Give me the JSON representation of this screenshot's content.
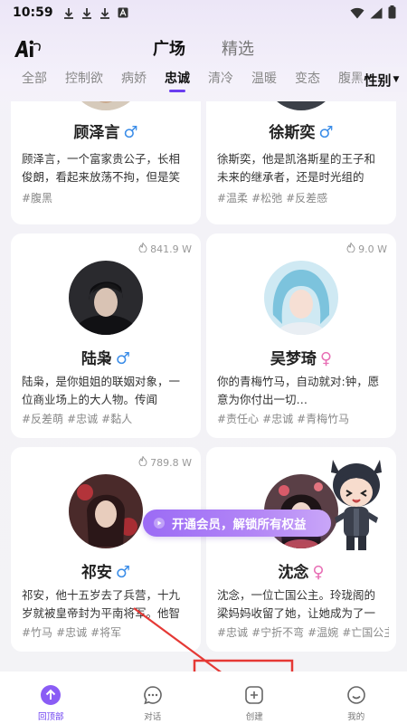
{
  "status_bar": {
    "time": "10:59"
  },
  "header": {
    "tabs": [
      {
        "label": "广场"
      },
      {
        "label": "精选"
      }
    ]
  },
  "categories": {
    "items": [
      "全部",
      "控制欲",
      "病娇",
      "忠诚",
      "清冷",
      "温暖",
      "变态",
      "腹黑"
    ],
    "active": "忠诚",
    "gender_filter": "性别"
  },
  "cards": [
    {
      "name": "顾泽言",
      "gender": "♂",
      "views": "",
      "desc": "顾泽言，一个富家贵公子，长相俊朗，看起来放荡不拘，但是笑起…",
      "tags": [
        "#腹黑"
      ]
    },
    {
      "name": "徐斯奕",
      "gender": "♂",
      "views": "",
      "desc": "徐斯奕，他是凯洛斯星的王子和未来的继承者，还是时光组的组…",
      "tags": [
        "#温柔",
        "#松弛",
        "#反差感"
      ]
    },
    {
      "name": "陆枭",
      "gender": "♂",
      "views": "841.9 W",
      "desc": "陆枭，是你姐姐的联姻对象，一位商业场上的大人物。传闻",
      "tags": [
        "#反差萌",
        "#忠诚",
        "#黏人"
      ]
    },
    {
      "name": "吴梦琦",
      "gender": "♀",
      "views": "9.0 W",
      "desc": "你的青梅竹马，自动就对:钟，愿意为你付出一切…",
      "tags": [
        "#责任心",
        "#忠诚",
        "#青梅竹马"
      ]
    },
    {
      "name": "祁安",
      "gender": "♂",
      "views": "789.8 W",
      "desc": "祁安，他十五岁去了兵营，十九岁就被皇帝封为平南将军。他智谋…",
      "tags": [
        "#竹马",
        "#忠诚",
        "#将军"
      ]
    },
    {
      "name": "沈念",
      "gender": "♀",
      "views": "",
      "desc": "沈念，一位亡国公主。玲珑阁的梁妈妈收留了她，让她成为了一名…",
      "tags": [
        "#忠诚",
        "#宁折不弯",
        "#温婉",
        "#亡国公主"
      ]
    }
  ],
  "promo": {
    "label": "开通会员，解锁所有权益"
  },
  "bottom_nav": [
    {
      "label": "回顶部"
    },
    {
      "label": "对话"
    },
    {
      "label": "创建"
    },
    {
      "label": "我的"
    }
  ],
  "colors": {
    "accent": "#6a3df0",
    "male": "#3b8de8",
    "female": "#e86fb5",
    "annotation": "#e53935"
  }
}
